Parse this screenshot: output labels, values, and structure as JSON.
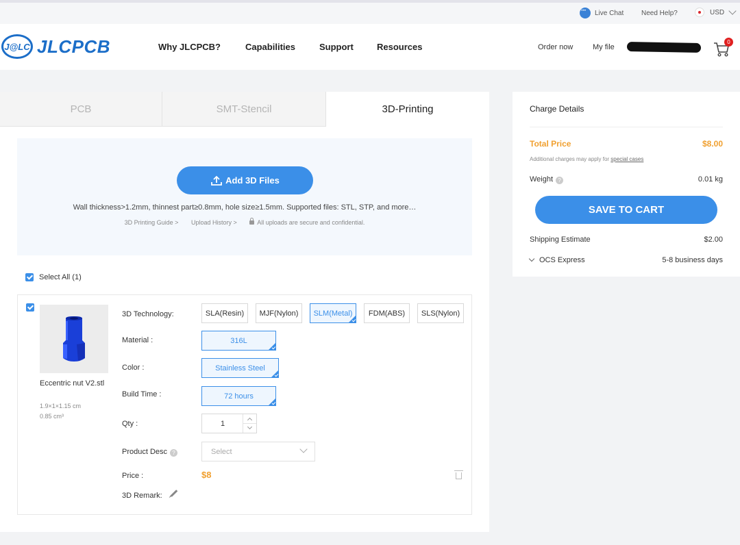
{
  "utility": {
    "live_chat": "Live Chat",
    "need_help": "Need Help?",
    "currency": "USD"
  },
  "brand": {
    "mark": "J@LC",
    "name": "JLCPCB",
    "color": "#1c6ec8"
  },
  "nav": [
    "Why JLCPCB?",
    "Capabilities",
    "Support",
    "Resources"
  ],
  "header": {
    "order_now": "Order now",
    "my_file": "My file",
    "cart_count": "0"
  },
  "tabs": [
    {
      "label": "PCB",
      "active": false
    },
    {
      "label": "SMT-Stencil",
      "active": false
    },
    {
      "label": "3D-Printing",
      "active": true
    }
  ],
  "upload": {
    "button": "Add 3D Files",
    "hint": "Wall thickness>1.2mm, thinnest part≥0.8mm, hole size≥1.5mm. Supported files: STL, STP, and more…",
    "guide_link": "3D Printing Guide >",
    "history_link": "Upload History >",
    "secure_note": "All uploads are secure and confidential."
  },
  "select_all": "Select All (1)",
  "item": {
    "file_name": "Eccentric nut V2.stl",
    "dimensions": "1.9×1×1.15 cm",
    "volume": "0.85 cm³",
    "labels": {
      "technology": "3D Technology:",
      "material": "Material :",
      "color": "Color :",
      "build_time": "Build Time :",
      "qty": "Qty :",
      "product_desc": "Product Desc",
      "price": "Price :",
      "remark": "3D Remark:"
    },
    "technologies": [
      {
        "label": "SLA(Resin)",
        "selected": false
      },
      {
        "label": "MJF(Nylon)",
        "selected": false
      },
      {
        "label": "SLM(Metal)",
        "selected": true
      },
      {
        "label": "FDM(ABS)",
        "selected": false
      },
      {
        "label": "SLS(Nylon)",
        "selected": false
      }
    ],
    "material": "316L",
    "color": "Stainless Steel",
    "build_time": "72 hours",
    "qty": "1",
    "product_desc_placeholder": "Select",
    "price": "$8"
  },
  "charge": {
    "title": "Charge Details",
    "total_label": "Total Price",
    "total_value": "$8.00",
    "note": "Additional charges may apply for",
    "note_link": "special cases",
    "weight_label": "Weight",
    "weight_value": "0.01 kg",
    "save_button": "SAVE TO CART",
    "shipping_label": "Shipping Estimate",
    "shipping_value": "$2.00",
    "carrier": "OCS Express",
    "delivery": "5-8 business days"
  },
  "colors": {
    "accent": "#3b8fe8",
    "price": "#f0a030",
    "badge": "#e02020"
  }
}
